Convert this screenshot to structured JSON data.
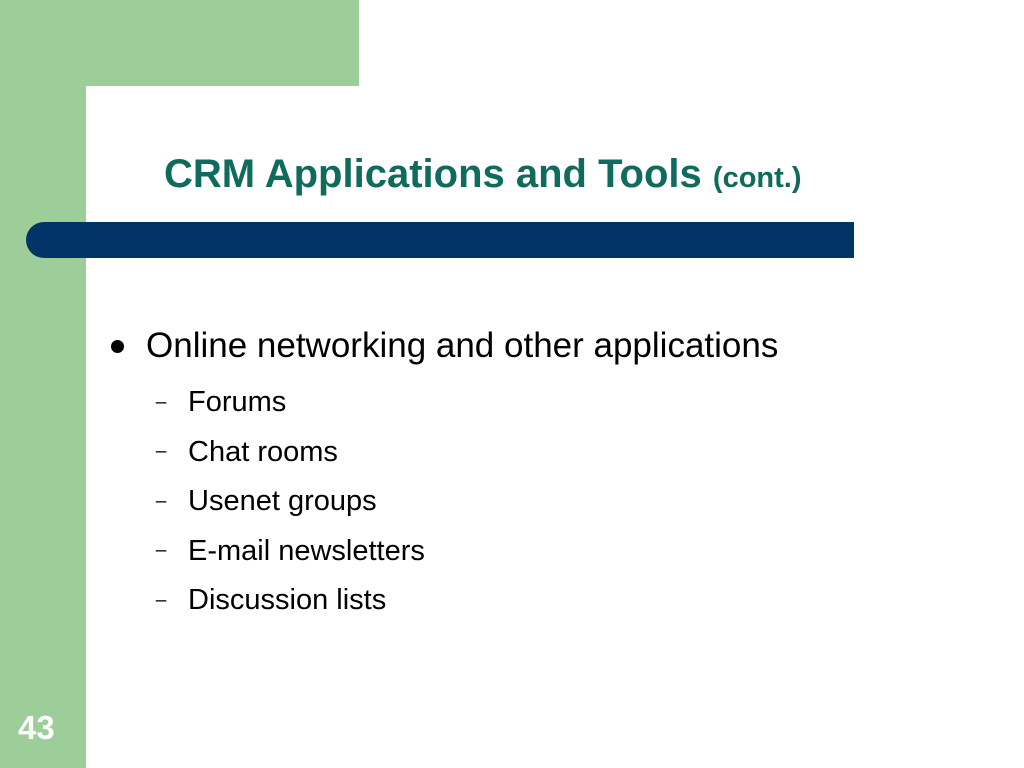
{
  "slide": {
    "title": "CRM Applications and Tools",
    "title_suffix": "(cont.)",
    "bullet": "Online networking and other applications",
    "dash_glyph": "–",
    "sub_items": [
      "Forums",
      "Chat rooms",
      "Usenet groups",
      "E-mail newsletters",
      "Discussion lists"
    ],
    "page_number": "43"
  },
  "colors": {
    "side_band": "#9dcd98",
    "title_text": "#0f6b5c",
    "title_bar": "#003466",
    "body_text": "#000000",
    "page_number": "#ffffff"
  }
}
